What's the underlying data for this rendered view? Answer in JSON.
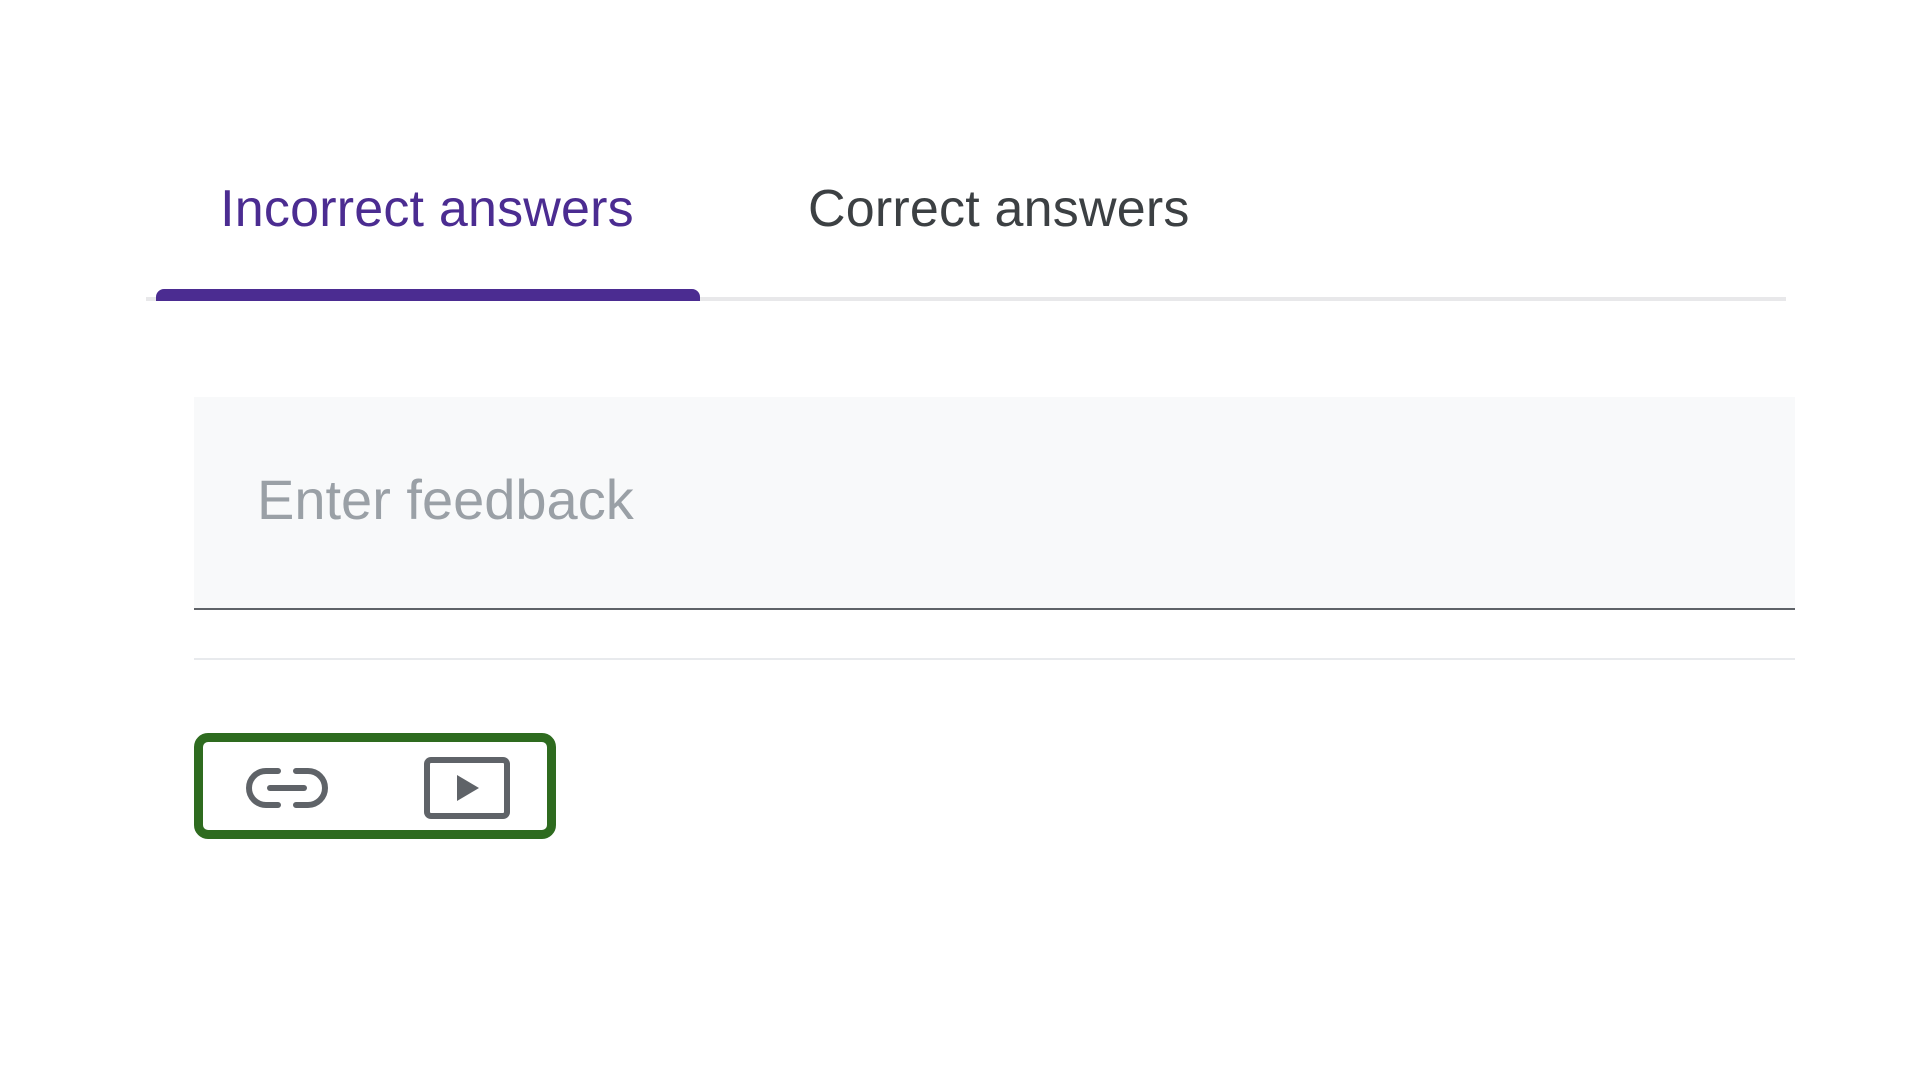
{
  "tabs": [
    {
      "label": "Incorrect answers",
      "active": true
    },
    {
      "label": "Correct answers",
      "active": false
    }
  ],
  "feedback": {
    "value": "",
    "placeholder": "Enter feedback"
  },
  "toolbar": {
    "icons": [
      "link-icon",
      "video-icon"
    ]
  },
  "colors": {
    "active_tab": "#4b2c91",
    "inactive_tab": "#3c4043",
    "indicator": "#4b2c91",
    "highlight_border": "#2e6b1f",
    "icon": "#5f6368"
  }
}
